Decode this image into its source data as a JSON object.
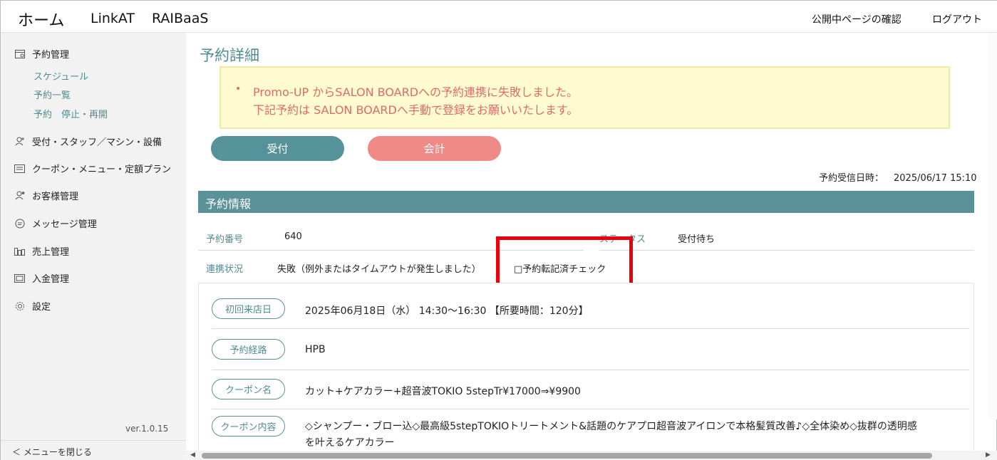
{
  "topbar": {
    "home": "ホーム",
    "nav_linkat": "LinkAT",
    "nav_raibaas": "RAIBaaS",
    "public_page_check": "公開中ページの確認",
    "logout": "ログアウト"
  },
  "sidebar": {
    "reservation_mgmt": "予約管理",
    "sub_schedule": "スケジュール",
    "sub_list": "予約一覧",
    "sub_pause": "予約　停止・再開",
    "reception_staff": "受付・スタッフ／マシン・設備",
    "coupon_menu": "クーポン・メニュー・定額プラン",
    "customer_mgmt": "お客様管理",
    "message_mgmt": "メッセージ管理",
    "sales_mgmt": "売上管理",
    "payment_mgmt": "入金管理",
    "settings": "設定",
    "version": "ver.1.0.15",
    "close_menu": "＜  メニューを閉じる"
  },
  "main": {
    "title": "予約詳細",
    "alert_bullet": "•",
    "alert_line1": "Promo-UP からSALON BOARDへの予約連携に失敗しました。",
    "alert_line2": "下記予約は SALON BOARDへ手動で登録をお願いいたします。",
    "btn_reception": "受付",
    "btn_checkout": "会計",
    "received_label": "予約受信日時：",
    "received_value": "2025/06/17 15:10",
    "section_title": "予約情報",
    "reservation_no_label": "予約番号",
    "reservation_no_value": "640",
    "status_label": "ステータス",
    "status_value": "受付待ち",
    "link_status_label": "連携状況",
    "link_status_value": "失敗（例外またはタイムアウトが発生しました）",
    "transfer_check": "□予約転記済チェック",
    "first_visit_label": "初回来店日",
    "first_visit_value": "2025年06月18日（水） 14:30〜16:30 【所要時間：120分】",
    "route_label": "予約経路",
    "route_value": "HPB",
    "coupon_name_label": "クーポン名",
    "coupon_name_value": "カット+ケアカラー+超音波TOKIO 5stepTr¥17000⇒¥9900",
    "coupon_content_label": "クーポン内容",
    "coupon_content_line1": "◇シャンプー・ブロー込◇最高級5stepTOKIOトリートメント&話題のケアプロ超音波アイロンで本格髪質改善♪◇全体染め◇抜群の透明感",
    "coupon_content_line2": "を叶えるケアカラー"
  },
  "colors": {
    "accent": "#5b9198",
    "checkout": "#ef8a87",
    "alert_bg": "#fdfbcf",
    "alert_text": "#e06a6a",
    "highlight_box": "#e8000b"
  }
}
